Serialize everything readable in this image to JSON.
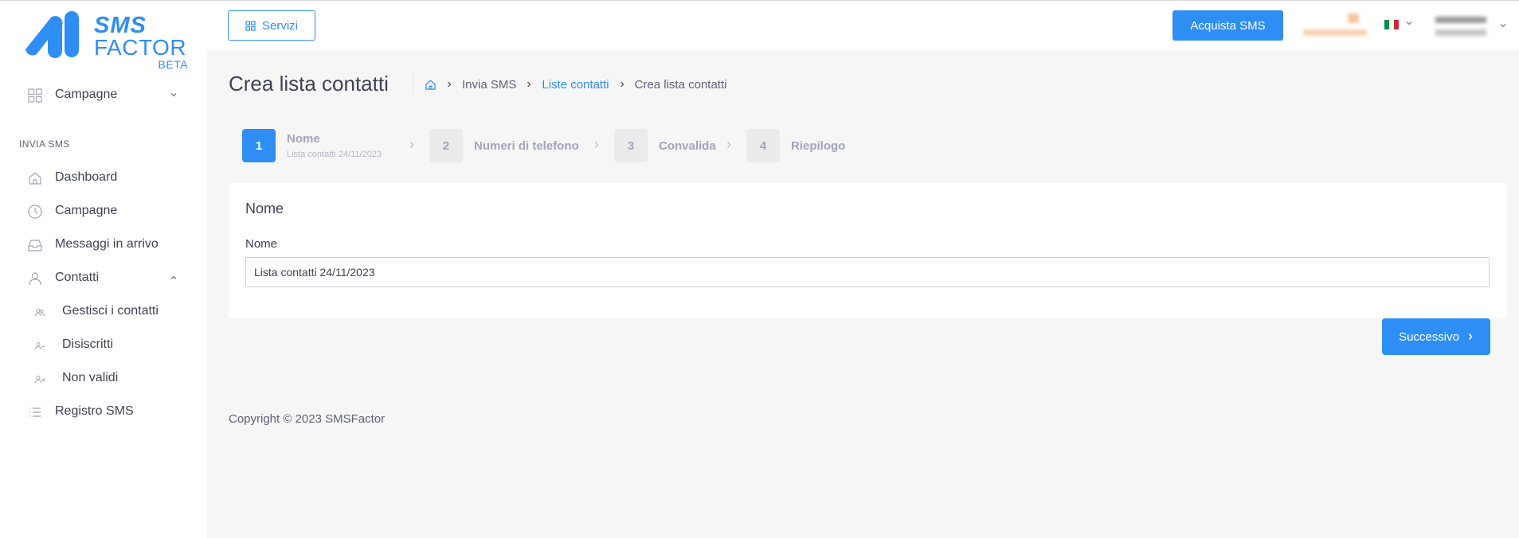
{
  "brand": {
    "line1": "SMS",
    "line2": "FACTOR",
    "badge": "BETA",
    "color": "#2e8ef3"
  },
  "header": {
    "servizi_label": "Servizi",
    "acquista_label": "Acquista SMS",
    "language": "Italian flag"
  },
  "sidebar": {
    "top_item": {
      "label": "Campagne",
      "icon": "grid-icon"
    },
    "section": "INVIA SMS",
    "items": [
      {
        "label": "Dashboard",
        "icon": "home-icon"
      },
      {
        "label": "Campagne",
        "icon": "clock-icon"
      },
      {
        "label": "Messaggi in arrivo",
        "icon": "inbox-icon"
      },
      {
        "label": "Contatti",
        "icon": "user-icon",
        "expanded": true
      },
      {
        "label": "Gestisci i contatti",
        "icon": "users-icon"
      },
      {
        "label": "Disiscritti",
        "icon": "user-minus-icon"
      },
      {
        "label": "Non validi",
        "icon": "user-x-icon"
      },
      {
        "label": "Registro SMS",
        "icon": "list-icon"
      }
    ]
  },
  "page": {
    "title": "Crea lista contatti",
    "breadcrumb": [
      "Invia SMS",
      "Liste contatti",
      "Crea lista contatti"
    ]
  },
  "stepper": [
    {
      "num": "1",
      "title": "Nome",
      "desc": "Lista contatti 24/11/2023",
      "active": true
    },
    {
      "num": "2",
      "title": "Numeri di telefono"
    },
    {
      "num": "3",
      "title": "Convalida"
    },
    {
      "num": "4",
      "title": "Riepilogo"
    }
  ],
  "form": {
    "card_title": "Nome",
    "field_label": "Nome",
    "field_value": "Lista contatti 24/11/2023"
  },
  "actions": {
    "next_label": "Successivo"
  },
  "footer": {
    "copyright": "Copyright © 2023 SMSFactor"
  }
}
